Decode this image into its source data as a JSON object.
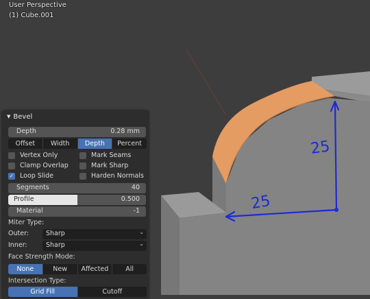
{
  "viewport": {
    "mode_label": "User Perspective",
    "object_label": "(1) Cube.001",
    "annotation_vertical": "25",
    "annotation_horizontal": "25",
    "colors": {
      "background": "#3d3d3d",
      "bevel_face": "#e49c63",
      "mesh": "#848484",
      "annotation": "#1d2ad4"
    }
  },
  "panel": {
    "title": "Bevel",
    "depth": {
      "label": "Depth",
      "value": "0.28 mm"
    },
    "width_type": {
      "options": [
        "Offset",
        "Width",
        "Depth",
        "Percent"
      ],
      "selected": "Depth"
    },
    "checks": [
      {
        "label": "Vertex Only",
        "checked": false
      },
      {
        "label": "Mark Seams",
        "checked": false
      },
      {
        "label": "Clamp Overlap",
        "checked": false
      },
      {
        "label": "Mark Sharp",
        "checked": false
      },
      {
        "label": "Loop Slide",
        "checked": true
      },
      {
        "label": "Harden Normals",
        "checked": false
      }
    ],
    "segments": {
      "label": "Segments",
      "value": "40"
    },
    "profile": {
      "label": "Profile",
      "value": "0.500",
      "fraction": 0.5
    },
    "material": {
      "label": "Material",
      "value": "-1"
    },
    "miter": {
      "label": "Miter Type:",
      "outer": {
        "label": "Outer:",
        "value": "Sharp"
      },
      "inner": {
        "label": "Inner:",
        "value": "Sharp"
      }
    },
    "face_strength": {
      "label": "Face Strength Mode:",
      "options": [
        "None",
        "New",
        "Affected",
        "All"
      ],
      "selected": "None"
    },
    "intersection": {
      "label": "Intersection Type:",
      "options": [
        "Grid Fill",
        "Cutoff"
      ],
      "selected": "Grid Fill"
    }
  }
}
